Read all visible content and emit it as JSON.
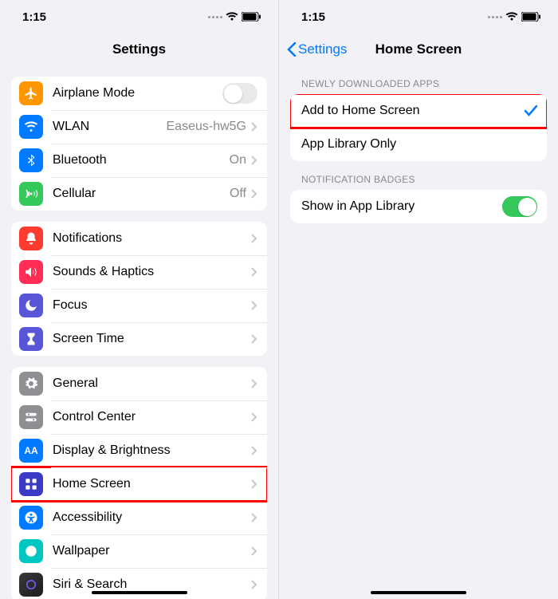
{
  "status": {
    "time": "1:15"
  },
  "left": {
    "title": "Settings",
    "section1": {
      "items": [
        {
          "label": "Airplane Mode",
          "icon": "airplane-icon",
          "color": "#ff9500",
          "control": "switch-off"
        },
        {
          "label": "WLAN",
          "icon": "wifi-icon",
          "color": "#007aff",
          "value": "Easeus-hw5G",
          "nav": true
        },
        {
          "label": "Bluetooth",
          "icon": "bluetooth-icon",
          "color": "#007aff",
          "value": "On",
          "nav": true
        },
        {
          "label": "Cellular",
          "icon": "antenna-icon",
          "color": "#34c759",
          "value": "Off",
          "nav": true
        }
      ]
    },
    "section2": {
      "items": [
        {
          "label": "Notifications",
          "icon": "bell-icon",
          "color": "#ff3b30",
          "nav": true
        },
        {
          "label": "Sounds & Haptics",
          "icon": "speaker-icon",
          "color": "#ff2d55",
          "nav": true
        },
        {
          "label": "Focus",
          "icon": "moon-icon",
          "color": "#5856d6",
          "nav": true
        },
        {
          "label": "Screen Time",
          "icon": "hourglass-icon",
          "color": "#5856d6",
          "nav": true
        }
      ]
    },
    "section3": {
      "items": [
        {
          "label": "General",
          "icon": "gear-icon",
          "color": "#8e8e93",
          "nav": true
        },
        {
          "label": "Control Center",
          "icon": "switches-icon",
          "color": "#8e8e93",
          "nav": true
        },
        {
          "label": "Display & Brightness",
          "icon": "aa-icon",
          "color": "#007aff",
          "nav": true
        },
        {
          "label": "Home Screen",
          "icon": "grid-icon",
          "color": "#3a3ac7",
          "nav": true,
          "highlight": true
        },
        {
          "label": "Accessibility",
          "icon": "person-icon",
          "color": "#007aff",
          "nav": true
        },
        {
          "label": "Wallpaper",
          "icon": "wallpaper-icon",
          "color": "#00c7c1",
          "nav": true
        },
        {
          "label": "Siri & Search",
          "icon": "siri-icon",
          "color": "",
          "nav": true
        }
      ]
    }
  },
  "right": {
    "back": "Settings",
    "title": "Home Screen",
    "section1": {
      "header": "NEWLY DOWNLOADED APPS",
      "items": [
        {
          "label": "Add to Home Screen",
          "checked": true,
          "highlight": true
        },
        {
          "label": "App Library Only"
        }
      ]
    },
    "section2": {
      "header": "NOTIFICATION BADGES",
      "items": [
        {
          "label": "Show in App Library",
          "control": "switch-on"
        }
      ]
    }
  }
}
